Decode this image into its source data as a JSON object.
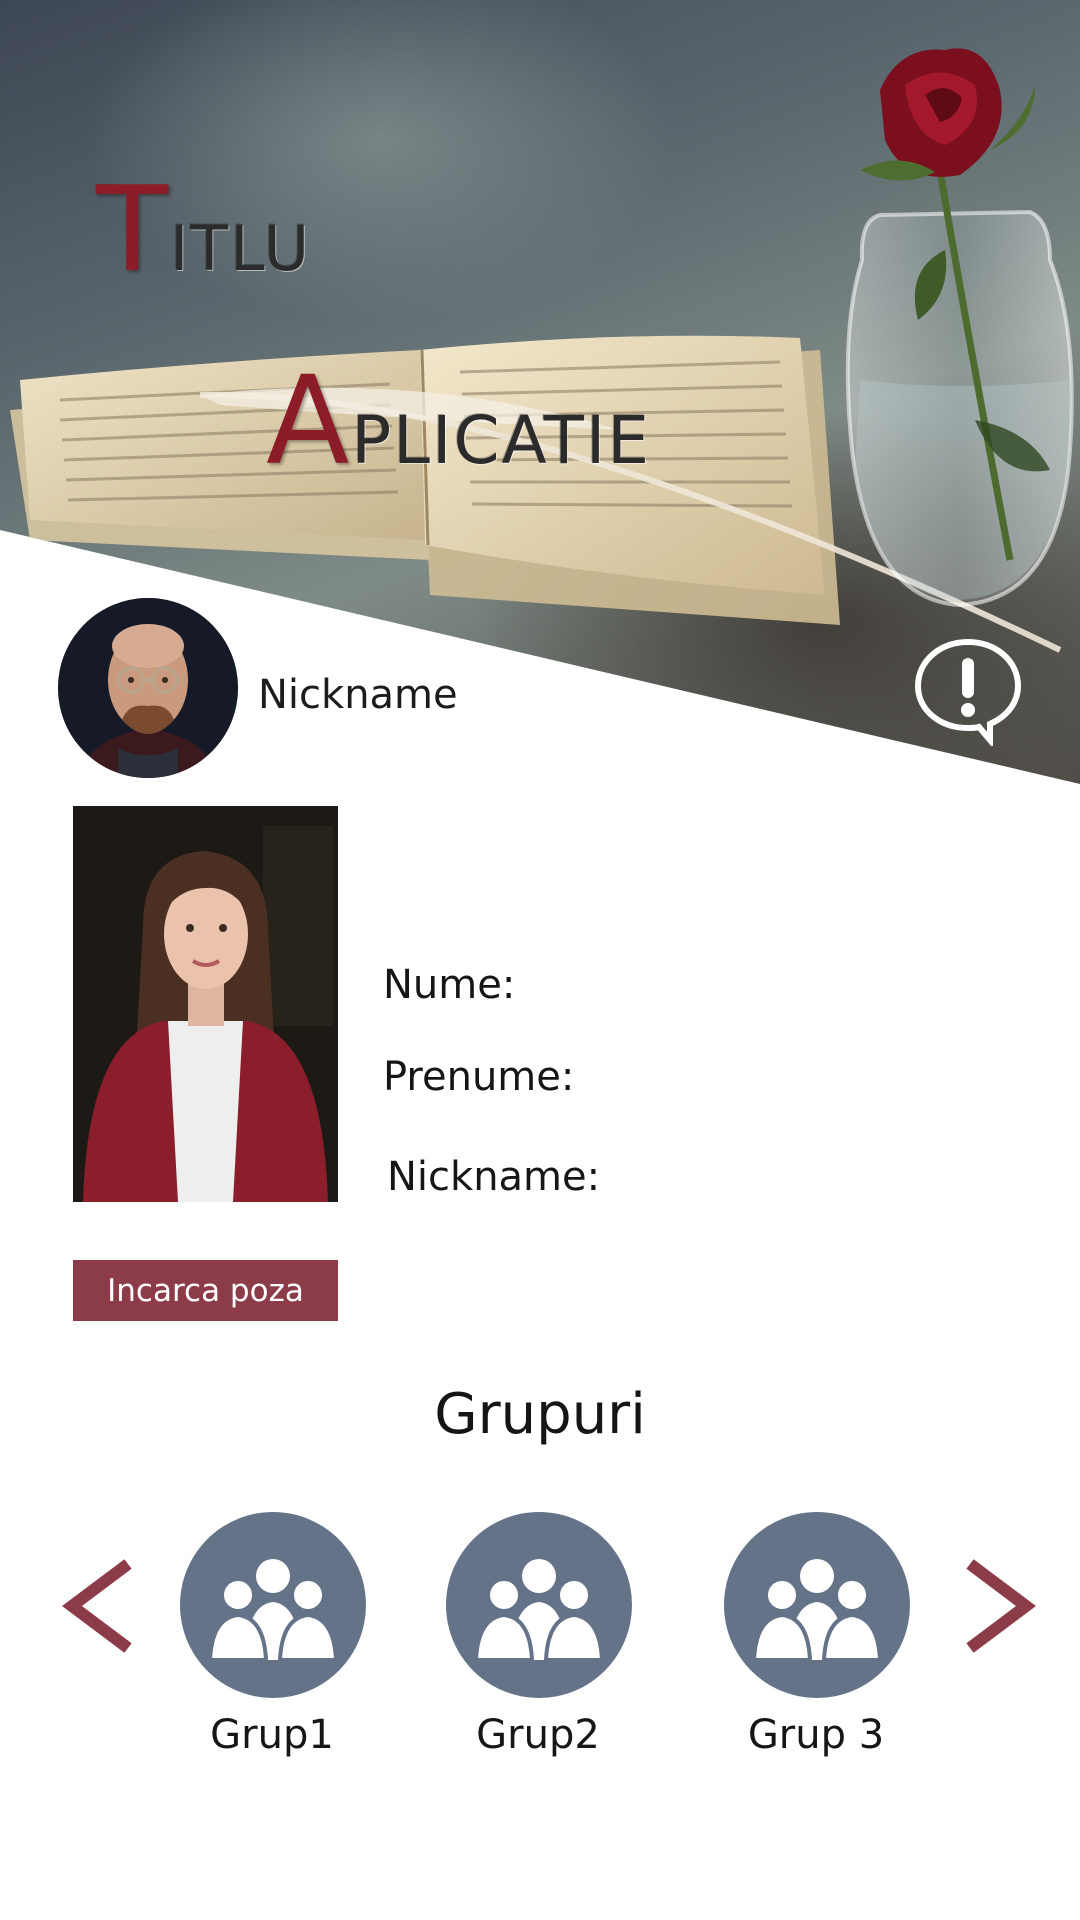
{
  "header": {
    "title_line1_initial": "T",
    "title_line1_rest": "ITLU",
    "title_line2_initial": "A",
    "title_line2_rest": "PLICATIE",
    "accent_color": "#8c1d28",
    "alert_icon": "exclamation-speech-bubble-icon"
  },
  "profile": {
    "nickname": "Nickname"
  },
  "details": {
    "nume_label": "Nume:",
    "prenume_label": "Prenume:",
    "nickname_label": "Nickname:"
  },
  "upload": {
    "label": "Incarca poza",
    "color": "#8c3b48"
  },
  "groups": {
    "title": "Grupuri",
    "prev_icon": "chevron-left-icon",
    "next_icon": "chevron-right-icon",
    "circle_color": "#657389",
    "items": [
      {
        "label": "Grup1",
        "icon": "group-users-icon"
      },
      {
        "label": "Grup2",
        "icon": "group-users-icon"
      },
      {
        "label": "Grup 3",
        "icon": "group-users-icon"
      }
    ]
  }
}
